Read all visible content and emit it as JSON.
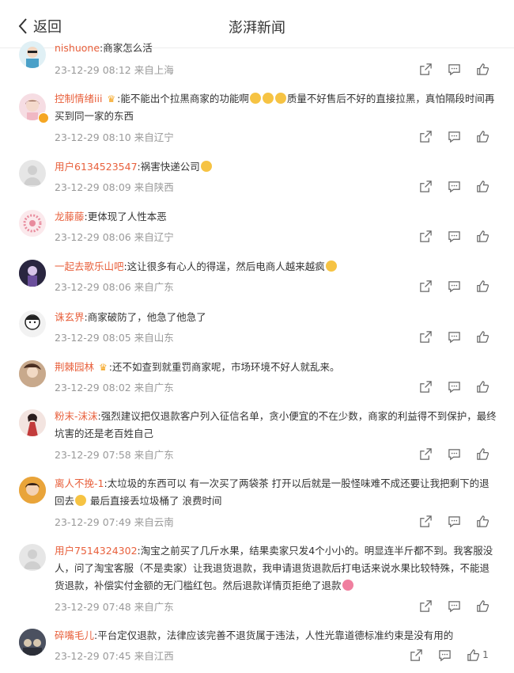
{
  "header": {
    "back_label": "返回",
    "title": "澎湃新闻"
  },
  "comments": [
    {
      "user": "nishuone",
      "text": "商家怎么活",
      "time": "23-12-29 08:12",
      "location": "来自上海"
    },
    {
      "user": "控制情绪iii",
      "text_a": "能不能出个拉黑商家的功能啊",
      "text_b": "质量不好售后不好的直接拉黑，真怕隔段时间再买到同一家的东西",
      "time": "23-12-29 08:10",
      "location": "来自辽宁"
    },
    {
      "user": "用户6134523547",
      "text": "祸害快递公司",
      "time": "23-12-29 08:09",
      "location": "来自陕西"
    },
    {
      "user": "龙藤藤",
      "text": "更体现了人性本恶",
      "time": "23-12-29 08:06",
      "location": "来自辽宁"
    },
    {
      "user": "一起去歌乐山吧",
      "text": "这让很多有心人的得逞，然后电商人越来越疯",
      "time": "23-12-29 08:06",
      "location": "来自广东"
    },
    {
      "user": "诛玄界",
      "text": "商家破防了，他急了他急了",
      "time": "23-12-29 08:05",
      "location": "来自山东"
    },
    {
      "user": "荆棘园林",
      "text": "还不如查到就重罚商家呢，市场环境不好人就乱来。",
      "time": "23-12-29 08:02",
      "location": "来自广东"
    },
    {
      "user": "粉末-沫沫",
      "text": "强烈建议把仅退款客户列入征信名单，贪小便宜的不在少数，商家的利益得不到保护，最终坑害的还是老百姓自己",
      "time": "23-12-29 07:58",
      "location": "来自广东"
    },
    {
      "user": "离人不挽-1",
      "text_a": "太垃圾的东西可以 有一次买了两袋茶 打开以后就是一股怪味难不成还要让我把剩下的退回去",
      "text_b": "最后直接丢垃圾桶了 浪费时间",
      "time": "23-12-29 07:49",
      "location": "来自云南"
    },
    {
      "user": "用户7514324302",
      "text": "淘宝之前买了几斤水果，结果卖家只发4个小小的。明显连半斤都不到。我客服没人，问了淘宝客服（不是卖家）让我退货退款，我申请退货退款后打电话来说水果比较特殊，不能退货退款，补偿实付金额的无门槛红包。然后退款详情页拒绝了退款",
      "time": "23-12-29 07:48",
      "location": "来自广东"
    },
    {
      "user": "碎嘴毛儿",
      "text": "平台定仅退款，法律应该完善不退货属于违法，人性光靠道德标准约束是没有用的",
      "time": "23-12-29 07:45",
      "location": "来自江西",
      "likes": "1"
    }
  ]
}
